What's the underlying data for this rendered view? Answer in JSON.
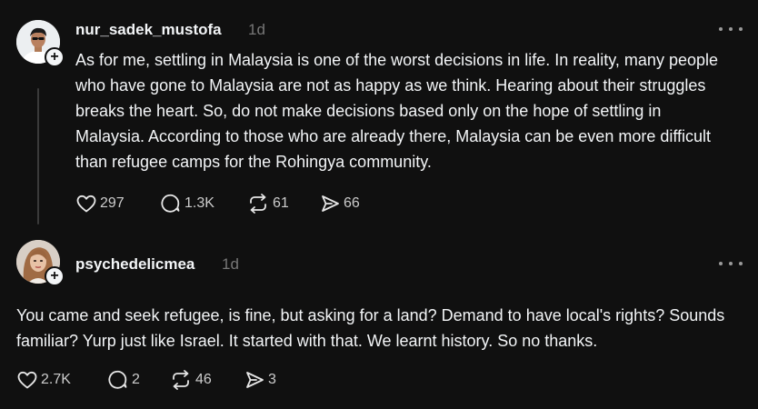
{
  "posts": [
    {
      "username": "nur_sadek_mustofa",
      "time": "1d",
      "text": "As for me, settling in Malaysia is one of the worst decisions in life. In reality, many people who have gone to Malaysia are not as happy as we think. Hearing about their struggles breaks the heart. So, do not make decisions based only on the hope of settling in Malaysia. According to those who are already there, Malaysia can be even more difficult than refugee camps for the Rohingya community.",
      "likes": "297",
      "replies": "1.3K",
      "reposts": "61",
      "shares": "66"
    },
    {
      "username": "psychedelicmea",
      "time": "1d",
      "text": "You came and seek refugee, is fine, but asking for a land? Demand to have local's rights? Sounds familiar? Yurp just like Israel. It started with that. We learnt history. So no thanks.",
      "likes": "2.7K",
      "replies": "2",
      "reposts": "46",
      "shares": "3"
    }
  ],
  "icons": {
    "add": "+",
    "like": "heart-icon",
    "reply": "comment-icon",
    "repost": "repost-icon",
    "share": "send-icon"
  },
  "colors": {
    "background": "#101010",
    "text": "#f3f5f7",
    "muted": "#777777"
  }
}
